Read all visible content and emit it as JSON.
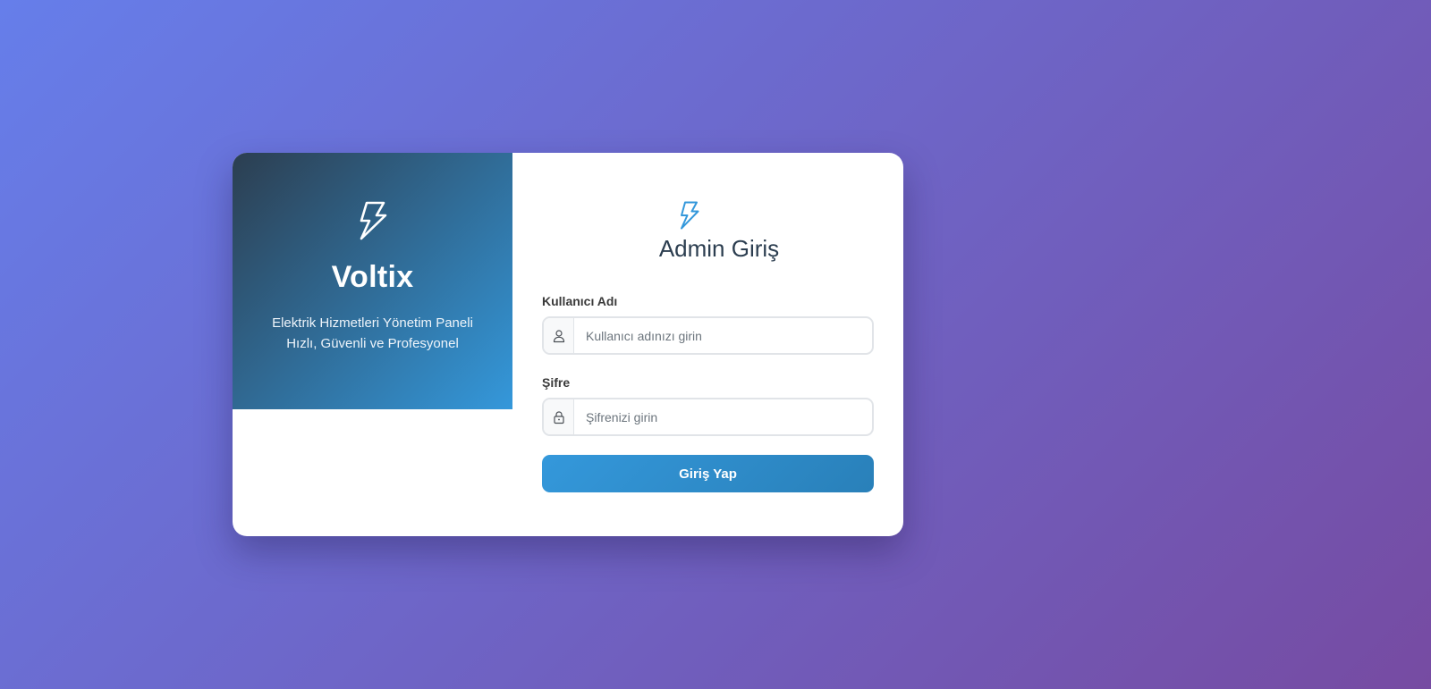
{
  "brand": {
    "icon": "lightning-bolt-icon",
    "name": "Voltix",
    "tagline_line1": "Elektrik Hizmetleri Yönetim Paneli",
    "tagline_line2": "Hızlı, Güvenli ve Profesyonel"
  },
  "form": {
    "icon": "lightning-bolt-icon",
    "title": "Admin Giriş",
    "username": {
      "label": "Kullanıcı Adı",
      "icon": "user-icon",
      "placeholder": "Kullanıcı adınızı girin",
      "value": ""
    },
    "password": {
      "label": "Şifre",
      "icon": "lock-icon",
      "placeholder": "Şifrenizi girin",
      "value": ""
    },
    "submit_label": "Giriş Yap"
  },
  "colors": {
    "background_start": "#667eea",
    "background_end": "#764ba2",
    "brand_panel_start": "#2c3e50",
    "brand_panel_end": "#3498db",
    "accent": "#3498db",
    "title_text": "#2c3e50"
  }
}
